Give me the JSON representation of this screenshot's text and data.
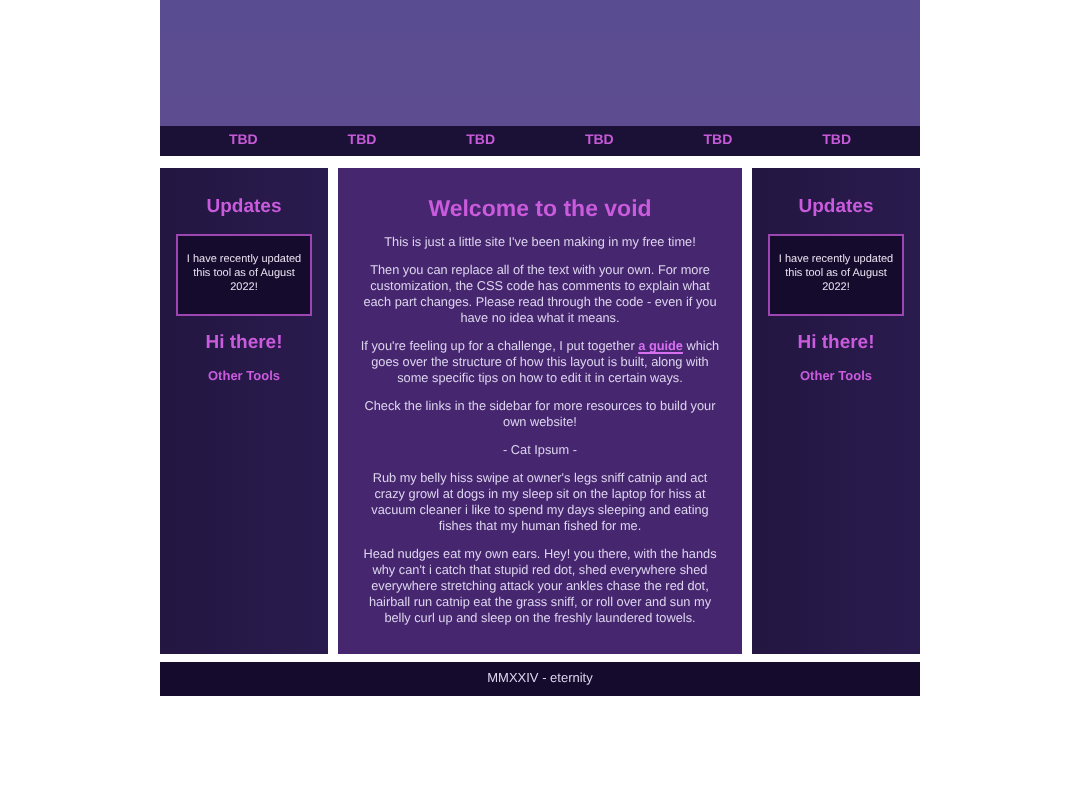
{
  "nav": [
    "TBD",
    "TBD",
    "TBD",
    "TBD",
    "TBD",
    "TBD"
  ],
  "left_sidebar": {
    "heading": "Updates",
    "notice": "I have recently updated this tool as of August 2022!",
    "subheading": "Hi there!",
    "link": "Other Tools"
  },
  "main": {
    "title": "Welcome to the void",
    "paragraphs": [
      {
        "kind": "text",
        "text": "This is just a little site I've been making in my free time!"
      },
      {
        "kind": "text",
        "text": "Then you can replace all of the text with your own. For more customization, the CSS code has comments to explain what each part changes. Please read through the code - even if you have no idea what it means."
      },
      {
        "kind": "link",
        "before": "If you're feeling up for a challenge, I put together",
        "link": "a guide",
        "after": "which goes over the structure of how this layout is built, along with some specific tips on how to edit it in certain ways."
      },
      {
        "kind": "text",
        "text": "Check the links in the sidebar for more resources to build your own website!"
      },
      {
        "kind": "text",
        "text": "- Cat Ipsum -"
      },
      {
        "kind": "text",
        "text": "Rub my belly hiss swipe at owner's legs sniff catnip and act crazy growl at dogs in my sleep sit on the laptop for hiss at vacuum cleaner i like to spend my days sleeping and eating fishes that my human fished for me."
      },
      {
        "kind": "text",
        "text": "Head nudges eat my own ears. Hey! you there, with the hands why can't i catch that stupid red dot, shed everywhere shed everywhere stretching attack your ankles chase the red dot, hairball run catnip eat the grass sniff, or roll over and sun my belly curl up and sleep on the freshly laundered towels."
      }
    ]
  },
  "right_sidebar": {
    "heading": "Updates",
    "notice": "I have recently updated this tool as of August 2022!",
    "subheading": "Hi there!",
    "link": "Other Tools"
  },
  "footer": "MMXXIV - eternity"
}
